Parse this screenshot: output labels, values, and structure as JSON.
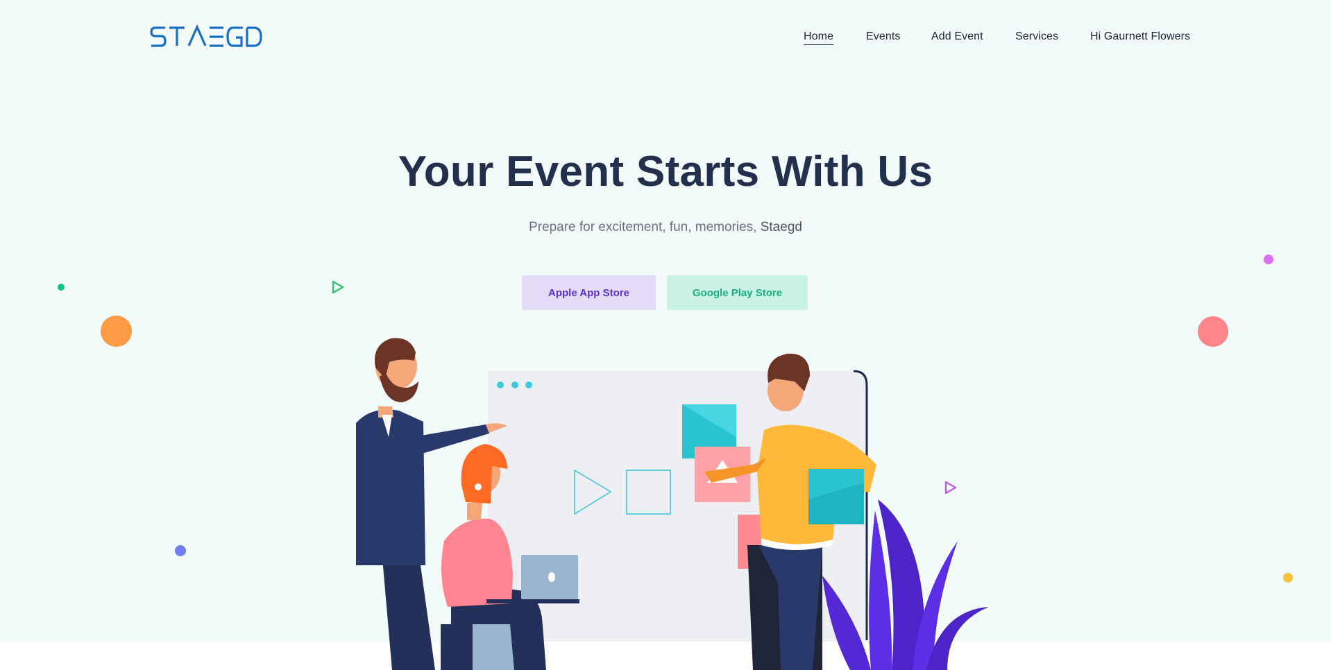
{
  "header": {
    "logo_text": "STAEGD",
    "nav": [
      {
        "label": "Home",
        "active": true
      },
      {
        "label": "Events",
        "active": false
      },
      {
        "label": "Add Event",
        "active": false
      },
      {
        "label": "Services",
        "active": false
      },
      {
        "label": "Hi Gaurnett Flowers",
        "active": false
      }
    ]
  },
  "hero": {
    "title": "Your Event Starts With Us",
    "subtitle": "Prepare for excitement, fun, memories,",
    "subtitle_brand": "Staegd",
    "buttons": {
      "apple": "Apple App Store",
      "google": "Google Play Store"
    }
  },
  "colors": {
    "background": "#f3fbfa",
    "title": "#22304d",
    "logo": "#1a6fc4",
    "apple_button_bg": "#e4dcf7",
    "apple_button_text": "#5b2fd3",
    "google_button_bg": "#cbf2e6",
    "google_button_text": "#16b07f"
  },
  "icons": {
    "logo": "staegd-logo",
    "play": "play-triangle-icon",
    "illustration": "team-working-illustration"
  }
}
